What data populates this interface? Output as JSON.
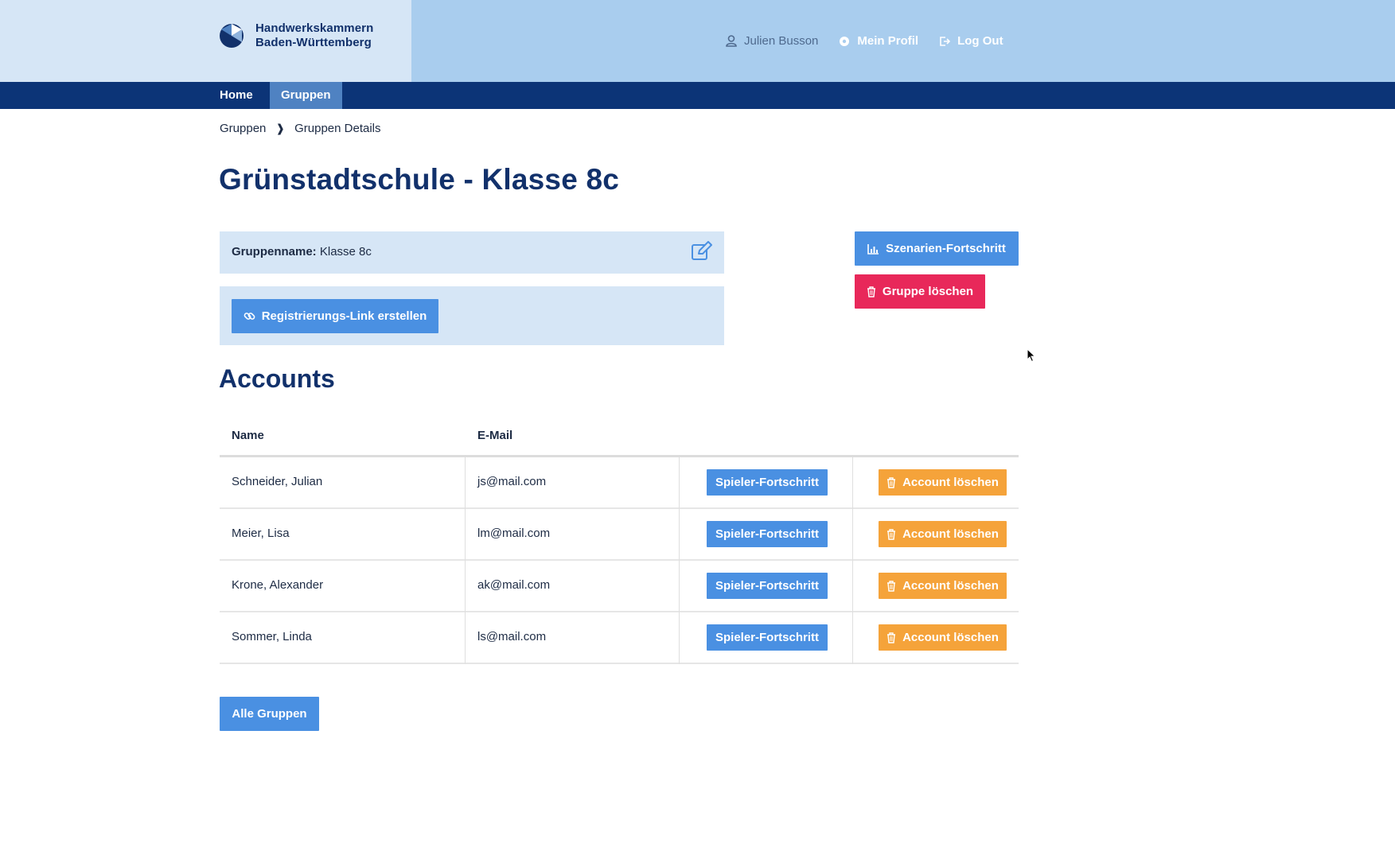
{
  "header": {
    "logo_line1": "Handwerkskammern",
    "logo_line2": "Baden-Württemberg",
    "user_name": "Julien Busson",
    "profile_label": "Mein Profil",
    "logout_label": "Log Out"
  },
  "nav": {
    "home_label": "Home",
    "groups_label": "Gruppen",
    "active_tab": "Gruppen"
  },
  "breadcrumb": {
    "parent": "Gruppen",
    "separator": "❱",
    "current": "Gruppen Details"
  },
  "page": {
    "title": "Grünstadtschule - Klasse 8c"
  },
  "group_panel": {
    "name_label": "Gruppenname:",
    "name_value": "Klasse 8c",
    "reg_link_button": "Registrierungs-Link erstellen"
  },
  "actions": {
    "scenario_progress_button": "Szenarien-Fortschritt",
    "delete_group_button": "Gruppe löschen"
  },
  "accounts": {
    "title": "Accounts",
    "columns": [
      "Name",
      "E-Mail"
    ],
    "rows": [
      {
        "name": "Schneider, Julian",
        "email": "js@mail.com",
        "progress_button": "Spieler-Fortschritt",
        "delete_button": "Account löschen"
      },
      {
        "name": "Meier, Lisa",
        "email": "lm@mail.com",
        "progress_button": "Spieler-Fortschritt",
        "delete_button": "Account löschen"
      },
      {
        "name": "Krone, Alexander",
        "email": "ak@mail.com",
        "progress_button": "Spieler-Fortschritt",
        "delete_button": "Account löschen"
      },
      {
        "name": "Sommer, Linda",
        "email": "ls@mail.com",
        "progress_button": "Spieler-Fortschritt",
        "delete_button": "Account löschen"
      }
    ]
  },
  "footer_actions": {
    "all_groups_button": "Alle Gruppen"
  },
  "icons": {
    "logo": "hwk-logo-icon",
    "user": "user-icon",
    "profile": "gear-icon",
    "logout": "logout-icon",
    "edit": "edit-icon",
    "link": "link-icon",
    "chart": "bar-chart-icon",
    "trash": "trash-icon"
  },
  "colors": {
    "header_bg": "#a9cdee",
    "header_left_bg": "#d6e6f6",
    "navbar_bg": "#0c3477",
    "active_tab_bg": "#4f82c2",
    "primary_blue": "#4a90e2",
    "danger_red": "#e8285a",
    "warning_orange": "#f5a33a",
    "title_navy": "#12316b"
  }
}
